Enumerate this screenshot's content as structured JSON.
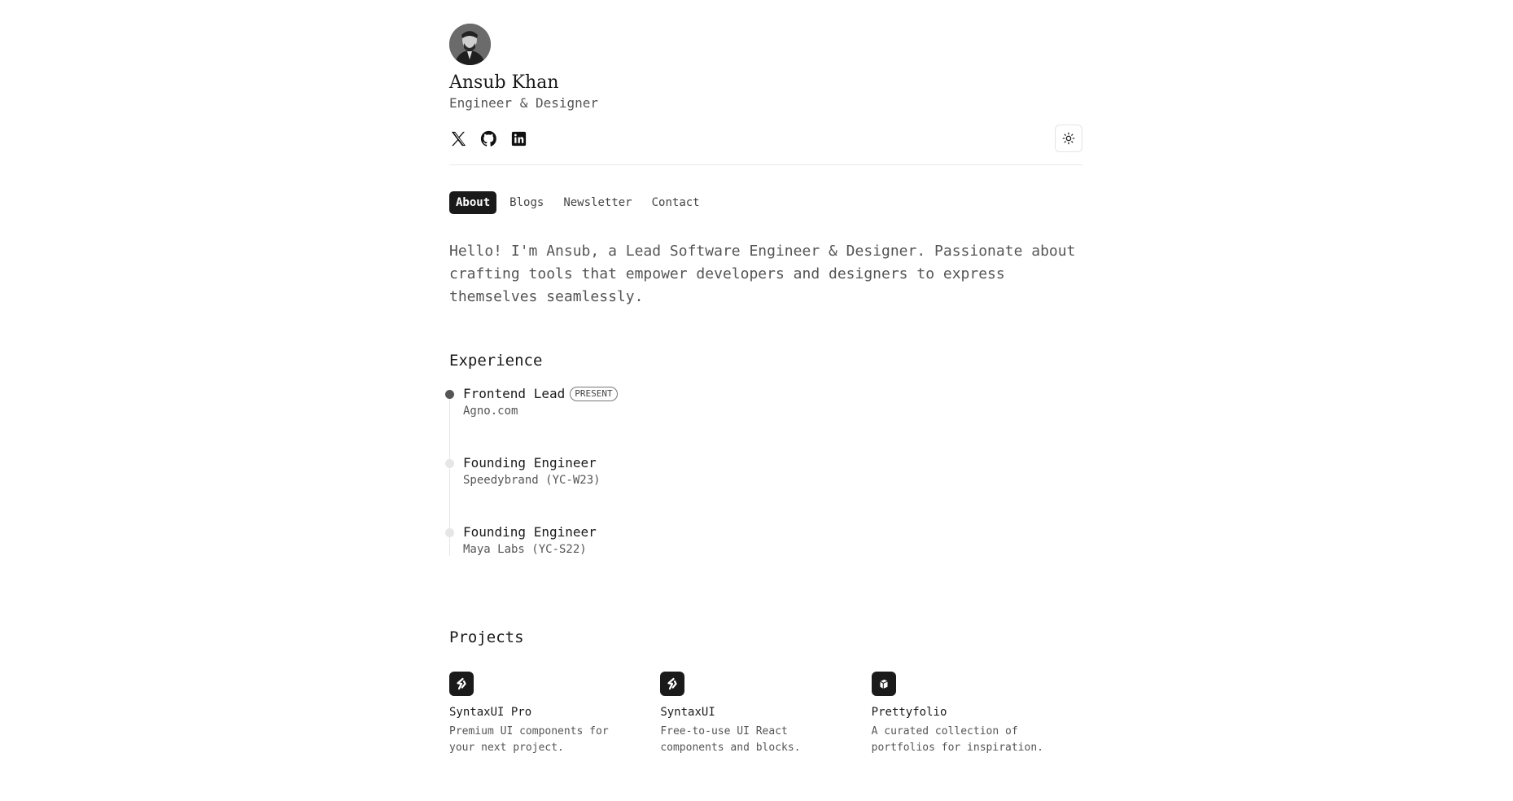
{
  "header": {
    "name": "Ansub Khan",
    "role": "Engineer & Designer",
    "social_icons": [
      "x-icon",
      "github-icon",
      "linkedin-icon"
    ],
    "theme_toggle_icon": "sun-icon"
  },
  "tabs": [
    {
      "label": "About",
      "active": true
    },
    {
      "label": "Blogs",
      "active": false
    },
    {
      "label": "Newsletter",
      "active": false
    },
    {
      "label": "Contact",
      "active": false
    }
  ],
  "intro": "Hello! I'm Ansub, a Lead Software Engineer & Designer. Passionate about crafting tools that empower developers and designers to express themselves seamlessly.",
  "experience": {
    "title": "Experience",
    "items": [
      {
        "title": "Frontend Lead",
        "badge": "PRESENT",
        "company": "Agno.com"
      },
      {
        "title": "Founding Engineer",
        "company": "Speedybrand (YC-W23)"
      },
      {
        "title": "Founding Engineer",
        "company": "Maya Labs (YC-S22)"
      }
    ]
  },
  "projects": {
    "title": "Projects",
    "items": [
      {
        "name": "SyntaxUI Pro",
        "description": "Premium UI components for your next project.",
        "icon": "syntaxui-logo-icon"
      },
      {
        "name": "SyntaxUI",
        "description": "Free-to-use UI React components and blocks.",
        "icon": "syntaxui-logo-icon"
      },
      {
        "name": "Prettyfolio",
        "description": "A curated collection of portfolios for inspiration.",
        "icon": "prettyfolio-logo-icon"
      }
    ]
  },
  "colors": {
    "text": "#1a1a1a",
    "muted": "#555555",
    "border": "#e8e8e8",
    "active_tab_bg": "#1a1a1a"
  }
}
